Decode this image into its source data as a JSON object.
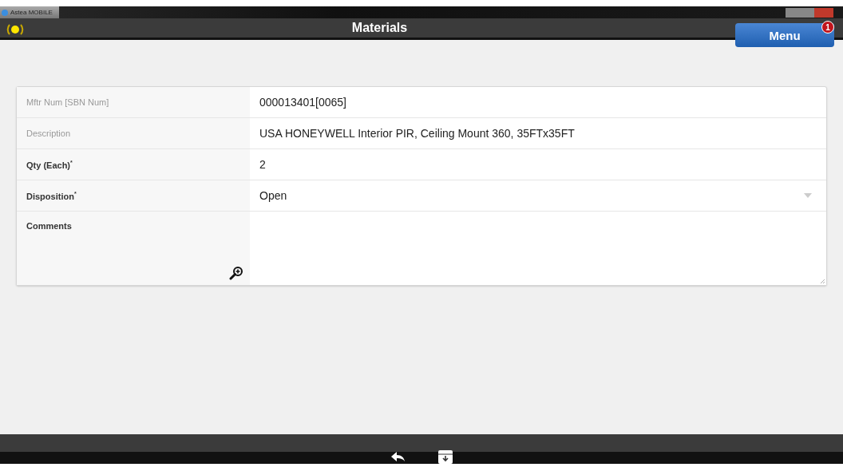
{
  "window": {
    "title": "Astea MOBILE"
  },
  "header": {
    "title": "Materials",
    "menu_button": "Menu",
    "badge": "1"
  },
  "fields": [
    {
      "kind": "text",
      "label": "Mftr Num [SBN Num]",
      "value": "000013401[0065]",
      "disabled": true
    },
    {
      "kind": "text",
      "label": "Description",
      "value": "USA HONEYWELL Interior PIR, Ceiling Mount 360, 35FTx35FT",
      "disabled": true
    },
    {
      "kind": "text",
      "label": "Qty (Each)$^{*}$",
      "value": "2",
      "disabled": false
    },
    {
      "kind": "select",
      "label": "Disposition$^{*}$",
      "value": "Open",
      "disabled": false
    },
    {
      "kind": "textarea",
      "label": "Comments",
      "disabled": false
    }
  ]
}
